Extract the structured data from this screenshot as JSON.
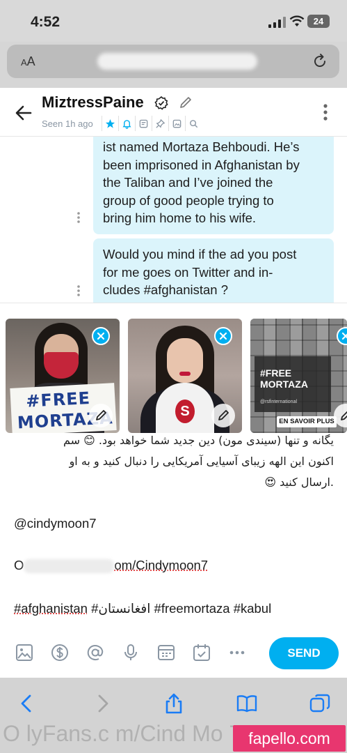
{
  "status_bar": {
    "time": "4:52",
    "battery": "24",
    "icons": [
      "signal-icon",
      "wifi-icon",
      "battery-icon"
    ]
  },
  "browser": {
    "text_size_label_small": "A",
    "text_size_label": "A",
    "reload_icon": "reload-icon"
  },
  "chat": {
    "username": "MiztressPaine",
    "seen": "Seen 1h ago",
    "header_icons": [
      "star-icon",
      "bell-icon",
      "note-icon",
      "pin-icon",
      "gallery-icon",
      "search-icon"
    ],
    "accent_color": "#00aff0",
    "bubble_color": "#dbf4fb"
  },
  "messages": [
    {
      "lines": [
        "ist named Mortaza Behboudi. He’s",
        "been imprisoned in Afghanistan by",
        "the Taliban and I’ve joined the",
        "group of good people trying to",
        "bring him home to his wife."
      ]
    },
    {
      "lines": [
        "Would you mind if the ad you post",
        "for me goes on Twitter and in-",
        "cludes #afghanistan ?"
      ]
    }
  ],
  "attachments": {
    "thumb1_sign_line1": "#FREE",
    "thumb1_sign_line2": "MORTAZA",
    "thumb3_line1": "#FREE",
    "thumb3_line2": "MORTAZA",
    "thumb3_small": "@rsfinternational",
    "thumb3_button": "EN SAVOIR PLUS"
  },
  "draft": {
    "rtl_line1": "یگانه و تنها (سیندی مون) دین جدید شما خواهد بود. 😊 سم",
    "rtl_line2": "اکنون این الهه زیبای آسیایی آمریکایی را دنبال کنید و به او",
    "rtl_line3": ".ارسال کنید 😍",
    "mention": "@cindymoon7",
    "url_prefix": "O",
    "url_suffix": "om/Cindymoon7",
    "tag1": "#afghanistan",
    "tag2": "#افغانستان",
    "tag3": "#freemortaza",
    "tag4": "#kabul"
  },
  "composer": {
    "send_label": "SEND",
    "tools": [
      "image-icon",
      "dollar-icon",
      "at-icon",
      "microphone-icon",
      "poll-icon",
      "schedule-icon",
      "more-icon"
    ]
  },
  "bottom": {
    "url_fragment": "O lyFans.c m/Cind Mo 7",
    "watermark": "fapello.com"
  }
}
